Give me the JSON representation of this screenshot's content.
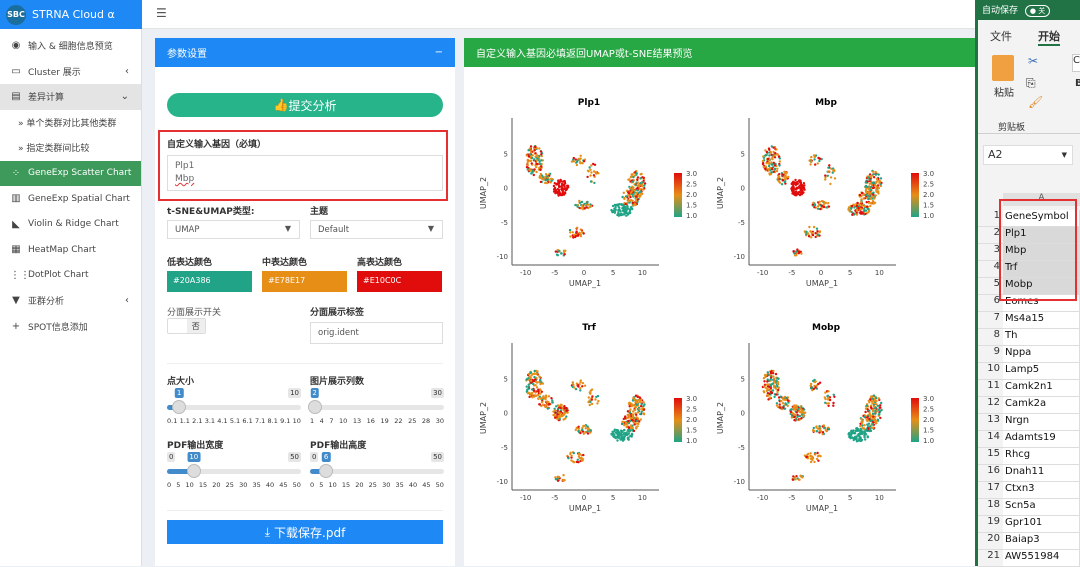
{
  "app": {
    "title": "STRNA Cloud α",
    "logo": "SBC"
  },
  "sidebar": {
    "items": [
      {
        "label": "输入 & 细胞信息预览",
        "icon": "eye-icon"
      },
      {
        "label": "Cluster 展示",
        "icon": "monitor-icon",
        "chevron": "‹"
      },
      {
        "label": "差异计算",
        "icon": "list-icon",
        "chevron": "⌄"
      },
      {
        "label": "» 单个类群对比其他类群"
      },
      {
        "label": "» 指定类群间比较"
      },
      {
        "label": "GeneExp Scatter Chart",
        "icon": "spinner-icon",
        "active": true
      },
      {
        "label": "GeneExp Spatial Chart",
        "icon": "map-icon"
      },
      {
        "label": "Violin & Ridge Chart",
        "icon": "area-chart-icon"
      },
      {
        "label": "HeatMap Chart",
        "icon": "table-icon"
      },
      {
        "label": "DotPlot Chart",
        "icon": "grid-icon"
      },
      {
        "label": "亚群分析",
        "icon": "filter-icon",
        "chevron": "‹"
      },
      {
        "label": "SPOT信息添加",
        "icon": "plus-icon"
      }
    ]
  },
  "topbar": {
    "menu_icon": "☰"
  },
  "params": {
    "title": "参数设置",
    "collapse": "−",
    "submit": "提交分析",
    "gene_label": "自定义输入基因（必填）",
    "genes": [
      "Plp1",
      "Mbp"
    ],
    "reduction_label": "t-SNE&UMAP类型:",
    "reduction_value": "UMAP",
    "theme_label": "主题",
    "theme_value": "Default",
    "low_label": "低表达颜色",
    "low_color": "#20A386",
    "mid_label": "中表达颜色",
    "mid_color": "#E78E17",
    "high_label": "高表达颜色",
    "high_color": "#E10C0C",
    "facet_switch_label": "分面展示开关",
    "facet_switch_value": "否",
    "facet_label_label": "分面展示标签",
    "facet_label_value": "orig.ident",
    "sliders": [
      {
        "label": "点大小",
        "min": "0.1",
        "max": "10",
        "value": "1",
        "fraction": 0.09,
        "ticks": [
          "0.1",
          "1.1",
          "2.1",
          "3.1",
          "4.1",
          "5.1",
          "6.1",
          "7.1",
          "8.1",
          "9.1",
          "10"
        ]
      },
      {
        "label": "图片展示列数",
        "min": "1",
        "max": "30",
        "value": "2",
        "fraction": 0.034,
        "ticks": [
          "1",
          "4",
          "7",
          "10",
          "13",
          "16",
          "19",
          "22",
          "25",
          "28",
          "30"
        ]
      },
      {
        "label": "PDF输出宽度",
        "min": "0",
        "max": "50",
        "value": "10",
        "fraction": 0.2,
        "ticks": [
          "0",
          "5",
          "10",
          "15",
          "20",
          "25",
          "30",
          "35",
          "40",
          "45",
          "50"
        ]
      },
      {
        "label": "PDF输出高度",
        "min": "0",
        "max": "50",
        "value": "6",
        "fraction": 0.12,
        "ticks": [
          "0",
          "5",
          "10",
          "15",
          "20",
          "25",
          "30",
          "35",
          "40",
          "45",
          "50"
        ]
      }
    ],
    "download": "下载保存.pdf"
  },
  "preview": {
    "title": "自定义输入基因必填返回UMAP或t-SNE结果预览",
    "plots": [
      {
        "gene": "Plp1"
      },
      {
        "gene": "Mbp"
      },
      {
        "gene": "Trf"
      },
      {
        "gene": "Mobp"
      }
    ],
    "xlabel": "UMAP_1",
    "ylabel": "UMAP_2",
    "xticks": [
      "-10",
      "-5",
      "0",
      "5",
      "10"
    ],
    "yticks": [
      "5",
      "0",
      "-5",
      "-10"
    ],
    "legend_ticks": [
      "3.0",
      "2.5",
      "2.0",
      "1.5",
      "1.0"
    ]
  },
  "excel": {
    "autosave": "自动保存",
    "autosave_state": "关",
    "tabs": [
      "文件",
      "开始"
    ],
    "paste": "粘贴",
    "clipboard": "剪贴板",
    "font_partial": "Ca",
    "bold_partial": "B",
    "namebox": "A2",
    "col": "A",
    "rows": [
      "GeneSymbol",
      "Plp1",
      "Mbp",
      "Trf",
      "Mobp",
      "Eomes",
      "Ms4a15",
      "Th",
      "Nppa",
      "Lamp5",
      "Camk2n1",
      "Camk2a",
      "Nrgn",
      "Adamts19",
      "Rhcg",
      "Dnah11",
      "Ctxn3",
      "Scn5a",
      "Gpr101",
      "Baiap3",
      "AW551984"
    ]
  }
}
